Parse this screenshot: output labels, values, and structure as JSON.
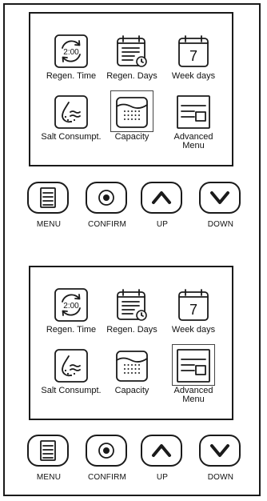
{
  "panels": [
    {
      "menu_items": [
        {
          "icon": "regen-time-icon",
          "label": "Regen. Time",
          "clock_text": "2:00"
        },
        {
          "icon": "regen-days-icon",
          "label": "Regen. Days"
        },
        {
          "icon": "week-days-icon",
          "label": "Week days",
          "calendar_text": "7"
        },
        {
          "icon": "salt-consumption-icon",
          "label": "Salt Consumpt."
        },
        {
          "icon": "capacity-icon",
          "label": "Capacity",
          "selected": true
        },
        {
          "icon": "advanced-menu-icon",
          "label": "Advanced\nMenu"
        }
      ],
      "buttons": [
        {
          "icon": "menu-icon",
          "label": "MENU"
        },
        {
          "icon": "confirm-icon",
          "label": "CONFIRM"
        },
        {
          "icon": "up-arrow-icon",
          "label": "UP"
        },
        {
          "icon": "down-arrow-icon",
          "label": "DOWN"
        }
      ]
    },
    {
      "menu_items": [
        {
          "icon": "regen-time-icon",
          "label": "Regen. Time",
          "clock_text": "2:00"
        },
        {
          "icon": "regen-days-icon",
          "label": "Regen. Days"
        },
        {
          "icon": "week-days-icon",
          "label": "Week days",
          "calendar_text": "7"
        },
        {
          "icon": "salt-consumption-icon",
          "label": "Salt Consumpt."
        },
        {
          "icon": "capacity-icon",
          "label": "Capacity"
        },
        {
          "icon": "advanced-menu-icon",
          "label": "Advanced\nMenu",
          "selected": true
        }
      ],
      "buttons": [
        {
          "icon": "menu-icon",
          "label": "MENU"
        },
        {
          "icon": "confirm-icon",
          "label": "CONFIRM"
        },
        {
          "icon": "up-arrow-icon",
          "label": "UP"
        },
        {
          "icon": "down-arrow-icon",
          "label": "DOWN"
        }
      ]
    }
  ],
  "colors": {
    "stroke": "#1a1a1a",
    "background": "#ffffff"
  }
}
